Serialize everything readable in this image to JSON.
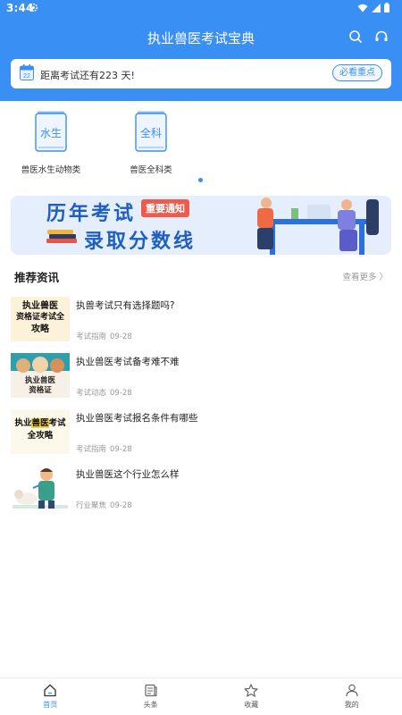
{
  "status": {
    "time": "3:44"
  },
  "header": {
    "title": "执业兽医考试宝典"
  },
  "countdown": {
    "text": "距离考试还有223 天!",
    "calendar_day": "22",
    "button": "必看重点"
  },
  "categories": [
    {
      "book_text": "水生",
      "label": "兽医水生动物类"
    },
    {
      "book_text": "全科",
      "label": "兽医全科类"
    }
  ],
  "banner": {
    "line1": "历年考试",
    "badge": "重要通知",
    "line2": "录取分数线"
  },
  "news_section": {
    "title": "推荐资讯",
    "more": "查看更多 〉"
  },
  "news": [
    {
      "title": "执兽考试只有选择题吗?",
      "category": "考试指南",
      "date": "09-28",
      "thumb_text": [
        "执业兽医",
        "资格证考试全",
        "攻略"
      ]
    },
    {
      "title": "执业兽医考试备考难不难",
      "category": "考试动态",
      "date": "09-28",
      "thumb_text": [
        "执业兽医",
        "资格证"
      ]
    },
    {
      "title": "执业兽医考试报名条件有哪些",
      "category": "考试指南",
      "date": "09-28",
      "thumb_text": [
        "执业",
        "兽医",
        "考试",
        "全攻略"
      ]
    },
    {
      "title": "执业兽医这个行业怎么样",
      "category": "行业聚焦",
      "date": "09-28"
    }
  ],
  "nav": [
    {
      "label": "首页",
      "icon": "home-icon",
      "active": true
    },
    {
      "label": "头条",
      "icon": "news-icon"
    },
    {
      "label": "收藏",
      "icon": "star-icon"
    },
    {
      "label": "我的",
      "icon": "user-icon"
    }
  ],
  "colors": {
    "primary": "#3a8ff5",
    "banner_text": "#1f5fc2",
    "badge": "#ee5a4b"
  }
}
